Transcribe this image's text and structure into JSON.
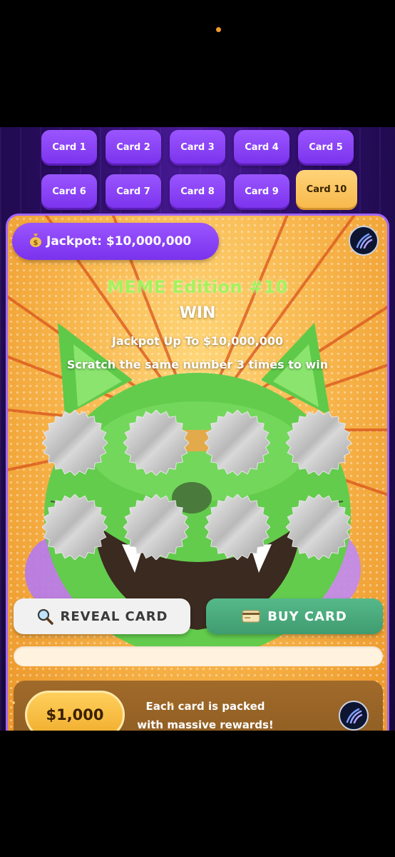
{
  "tabs": [
    {
      "label": "Card 1"
    },
    {
      "label": "Card 2"
    },
    {
      "label": "Card 3"
    },
    {
      "label": "Card 4"
    },
    {
      "label": "Card 5"
    },
    {
      "label": "Card 6"
    },
    {
      "label": "Card 7"
    },
    {
      "label": "Card 8"
    },
    {
      "label": "Card 9"
    },
    {
      "label": "Card 10"
    }
  ],
  "active_tab": "Card 10",
  "card": {
    "jackpot_icon": "money-bag-icon",
    "jackpot_label": "Jackpot: $10,000,000",
    "edition": "MEME Edition #10",
    "win": "WIN",
    "subtitle": "Jackpot Up To $10,000,000",
    "instruction": "Scratch the same number 3 times to win",
    "scratch_spots": 8
  },
  "buttons": {
    "reveal_icon": "magnifier-icon",
    "reveal_label": "REVEAL CARD",
    "buy_icon": "credit-card-icon",
    "buy_label": "BUY CARD"
  },
  "promo": {
    "price": "$1,000",
    "text": "Each card is packed with massive rewards!"
  },
  "colors": {
    "tab_purple": "#8a44f6",
    "tab_active": "#f7b84a",
    "card_orange": "#f7b44a",
    "buy_green": "#4aa97c",
    "reveal_white": "#f1f1f1",
    "edition_green": "#a4f25c"
  }
}
